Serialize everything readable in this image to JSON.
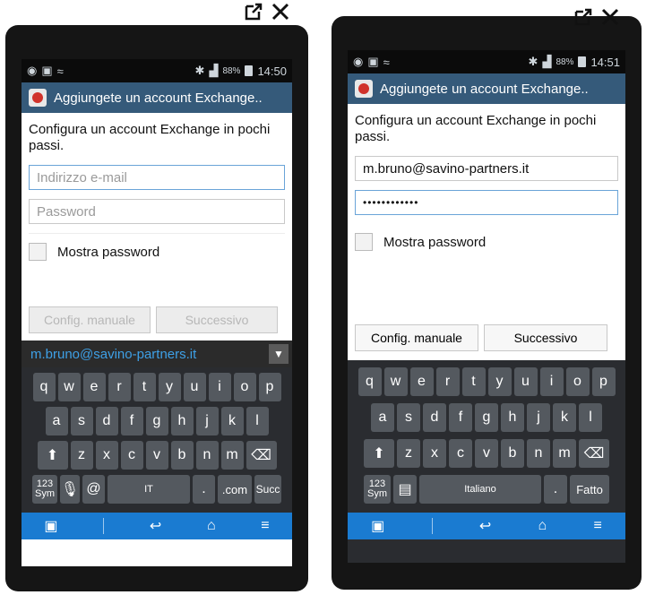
{
  "status": {
    "left_time": "14:50",
    "right_time": "14:51",
    "battery": "88%"
  },
  "title": "Aggiungete un account Exchange..",
  "intro": "Configura un account Exchange in pochi passi.",
  "left": {
    "email_placeholder": "Indirizzo e-mail",
    "password_placeholder": "Password",
    "suggestion": "m.bruno@savino-partners.it"
  },
  "right": {
    "email_value": "m.bruno@savino-partners.it",
    "password_value": "••••••••••••",
    "space_label": "Italiano",
    "done_label": "Fatto"
  },
  "show_password_label": "Mostra password",
  "manual_button": "Config. manuale",
  "next_button": "Successivo",
  "keyboard": {
    "row1": [
      "q",
      "w",
      "e",
      "r",
      "t",
      "y",
      "u",
      "i",
      "o",
      "p"
    ],
    "row2": [
      "a",
      "s",
      "d",
      "f",
      "g",
      "h",
      "j",
      "k",
      "l"
    ],
    "row3": [
      "z",
      "x",
      "c",
      "v",
      "b",
      "n",
      "m"
    ],
    "sym": "123 Sym",
    "at": "@",
    "dot": ".",
    "com": ".com",
    "succ": "Succ",
    "space_left_label": "IT"
  },
  "icons": {
    "external": "external-link-icon",
    "close": "close-icon"
  }
}
